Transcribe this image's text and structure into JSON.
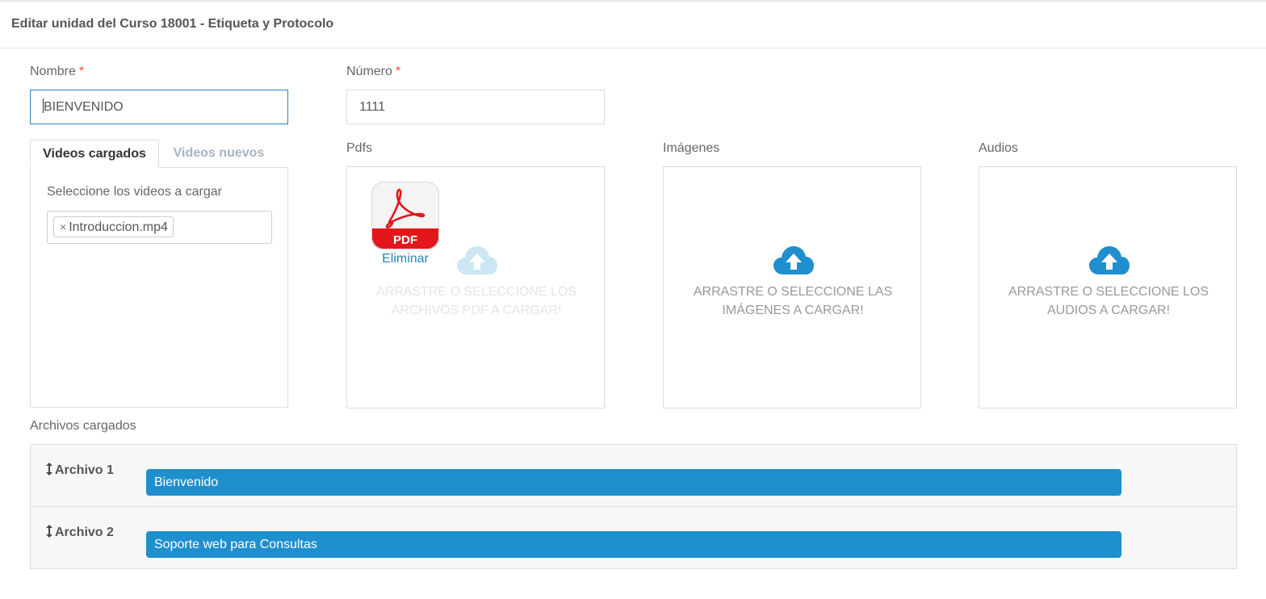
{
  "header": {
    "title": "Editar unidad del Curso 18001 - Etiqueta y Protocolo"
  },
  "form": {
    "nombre_label": "Nombre",
    "nombre_value": "BIENVENIDO",
    "numero_label": "Número",
    "numero_value": "1111",
    "required_mark": "*"
  },
  "videos": {
    "tabs": [
      "Videos cargados",
      "Videos nuevos"
    ],
    "active_tab": "Videos cargados",
    "select_label": "Seleccione los videos a cargar",
    "selected": [
      "Introduccion.mp4"
    ],
    "chip_remove": "×"
  },
  "pdfs": {
    "label": "Pdfs",
    "thumb_label": "PDF",
    "remove_label": "Eliminar",
    "drop_text": "ARRASTRE O SELECCIONE LOS ARCHIVOS PDF A CARGAR!"
  },
  "imagenes": {
    "label": "Imágenes",
    "drop_text": "ARRASTRE O SELECCIONE LAS IMÁGENES A CARGAR!"
  },
  "audios": {
    "label": "Audios",
    "drop_text": "ARRASTRE O SELECCIONE LOS AUDIOS A CARGAR!"
  },
  "archivos": {
    "label": "Archivos cargados",
    "items": [
      {
        "label": "Archivo 1",
        "value": "Bienvenido"
      },
      {
        "label": "Archivo 2",
        "value": "Soporte web para Consultas"
      }
    ]
  },
  "colors": {
    "accent": "#1f8fcd",
    "required": "#e74c3c",
    "cloud": "#1f8fcd",
    "pdf_red": "#e3161b"
  },
  "icons": [
    "cloud-upload-icon",
    "pdf-file-icon",
    "drag-handle-icon"
  ]
}
